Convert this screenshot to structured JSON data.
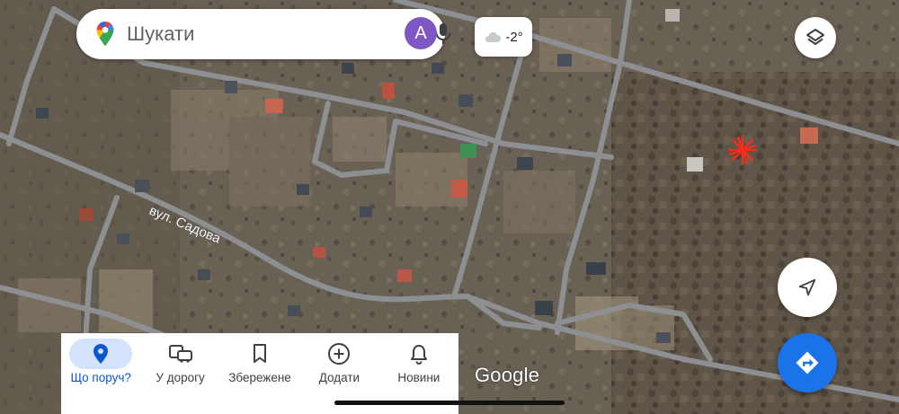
{
  "search": {
    "placeholder_text": "Шукати",
    "avatar_letter": "A"
  },
  "weather": {
    "temperature": "-2°"
  },
  "map": {
    "street_label": "вул. Садова",
    "attribution": "Google"
  },
  "nav": {
    "items": [
      {
        "label": "Що поруч?",
        "icon": "location-pin-icon",
        "active": true
      },
      {
        "label": "У дорогу",
        "icon": "commute-icon",
        "active": false
      },
      {
        "label": "Збережене",
        "icon": "bookmark-icon",
        "active": false
      },
      {
        "label": "Додати",
        "icon": "add-circle-icon",
        "active": false
      },
      {
        "label": "Новини",
        "icon": "bell-icon",
        "active": false
      }
    ]
  },
  "colors": {
    "accent": "#1a73e8",
    "marker": "#ff2a1a"
  }
}
